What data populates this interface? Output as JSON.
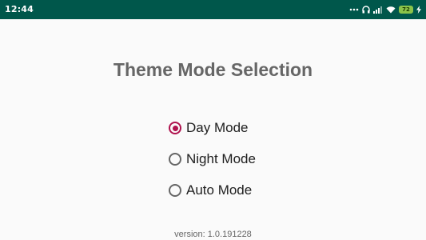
{
  "status_bar": {
    "time": "12:44",
    "battery_level": "72",
    "icons": [
      "dots-icon",
      "headphones-icon",
      "signal-icon",
      "wifi-icon",
      "battery-icon",
      "charging-icon"
    ]
  },
  "title": "Theme Mode Selection",
  "options": [
    {
      "label": "Day Mode",
      "selected": true
    },
    {
      "label": "Night Mode",
      "selected": false
    },
    {
      "label": "Auto Mode",
      "selected": false
    }
  ],
  "version": "version: 1.0.191228",
  "colors": {
    "status_bar": "#00574b",
    "accent": "#b0124e",
    "title": "#666666"
  }
}
